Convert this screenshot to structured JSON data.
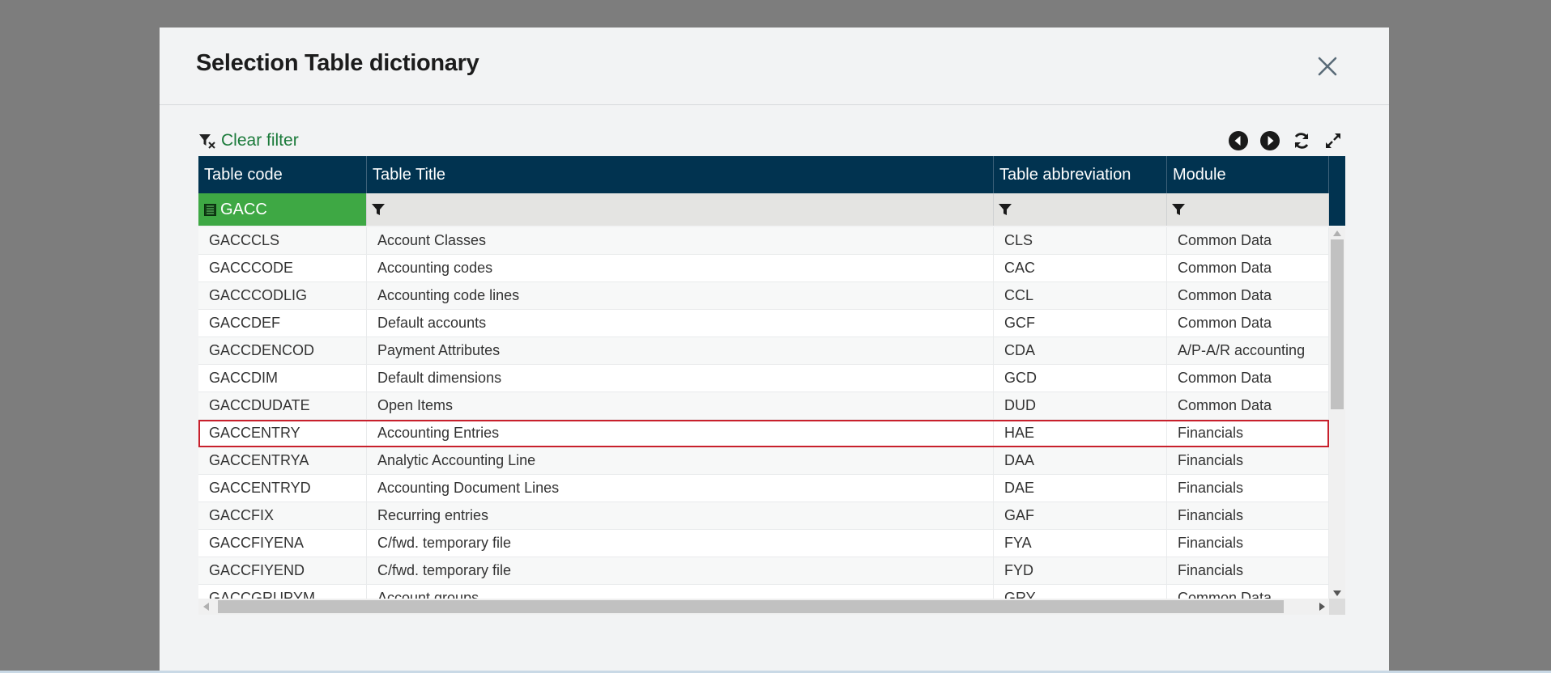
{
  "dialog": {
    "title": "Selection Table dictionary"
  },
  "toolbar": {
    "clear_filter_label": "Clear filter"
  },
  "columns": [
    {
      "label": "Table code"
    },
    {
      "label": "Table Title"
    },
    {
      "label": "Table abbreviation"
    },
    {
      "label": "Module"
    }
  ],
  "filters": {
    "table_code_value": "GACC"
  },
  "rows": [
    {
      "code": "GACCCLS",
      "title": "Account Classes",
      "abbr": "CLS",
      "module": "Common Data"
    },
    {
      "code": "GACCCODE",
      "title": "Accounting codes",
      "abbr": "CAC",
      "module": "Common Data"
    },
    {
      "code": "GACCCODLIG",
      "title": "Accounting code lines",
      "abbr": "CCL",
      "module": "Common Data"
    },
    {
      "code": "GACCDEF",
      "title": "Default accounts",
      "abbr": "GCF",
      "module": "Common Data"
    },
    {
      "code": "GACCDENCOD",
      "title": "Payment Attributes",
      "abbr": "CDA",
      "module": "A/P-A/R accounting"
    },
    {
      "code": "GACCDIM",
      "title": "Default dimensions",
      "abbr": "GCD",
      "module": "Common Data"
    },
    {
      "code": "GACCDUDATE",
      "title": "Open Items",
      "abbr": "DUD",
      "module": "Common Data"
    },
    {
      "code": "GACCENTRY",
      "title": "Accounting Entries",
      "abbr": "HAE",
      "module": "Financials"
    },
    {
      "code": "GACCENTRYA",
      "title": "Analytic Accounting Line",
      "abbr": "DAA",
      "module": "Financials"
    },
    {
      "code": "GACCENTRYD",
      "title": "Accounting Document Lines",
      "abbr": "DAE",
      "module": "Financials"
    },
    {
      "code": "GACCFIX",
      "title": "Recurring entries",
      "abbr": "GAF",
      "module": "Financials"
    },
    {
      "code": "GACCFIYENA",
      "title": "C/fwd. temporary file",
      "abbr": "FYA",
      "module": "Financials"
    },
    {
      "code": "GACCFIYEND",
      "title": "C/fwd. temporary file",
      "abbr": "FYD",
      "module": "Financials"
    },
    {
      "code": "GACCGRUPYM",
      "title": "Account groups",
      "abbr": "GRY",
      "module": "Common Data"
    }
  ],
  "colors": {
    "header_bg": "#013350",
    "filter_active": "#3ea844",
    "selection_outline": "#c8202c",
    "link_green": "#1b7a3a"
  }
}
